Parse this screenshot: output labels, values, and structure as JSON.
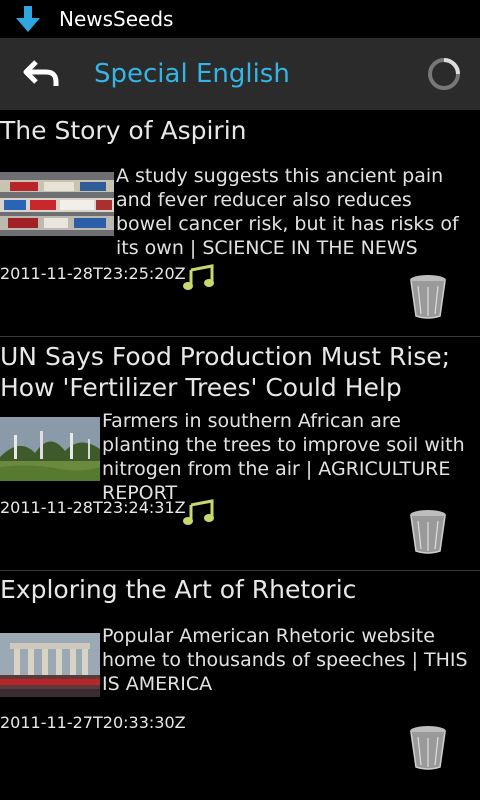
{
  "status_bar": {
    "app_name": "NewsSeeds"
  },
  "action_bar": {
    "title": "Special English"
  },
  "articles": [
    {
      "title": "The Story of Aspirin",
      "description": "A study suggests this ancient pain and fever reducer also reduces bowel cancer risk, but it has risks of its own | SCIENCE IN THE NEWS",
      "date": "2011-11-28T23:25:20Z",
      "has_audio": true
    },
    {
      "title": "UN Says Food Production Must Rise; How 'Fertilizer Trees' Could Help",
      "description": "Farmers in southern African are planting the trees to improve soil with nitrogen from the air | AGRICULTURE REPORT",
      "date": "2011-11-28T23:24:31Z",
      "has_audio": true
    },
    {
      "title": "Exploring the Art of Rhetoric",
      "description": "Popular American Rhetoric website home to thousands of speeches | THIS IS AMERICA",
      "date": "2011-11-27T20:33:30Z",
      "has_audio": false
    }
  ],
  "colors": {
    "accent": "#33b5e5",
    "audio_icon": "#c8d86a"
  },
  "icons": {
    "status": "download-arrow-icon",
    "back": "back-arrow-icon",
    "loading": "loading-spinner-icon",
    "audio": "music-note-icon",
    "delete": "trash-can-icon"
  }
}
